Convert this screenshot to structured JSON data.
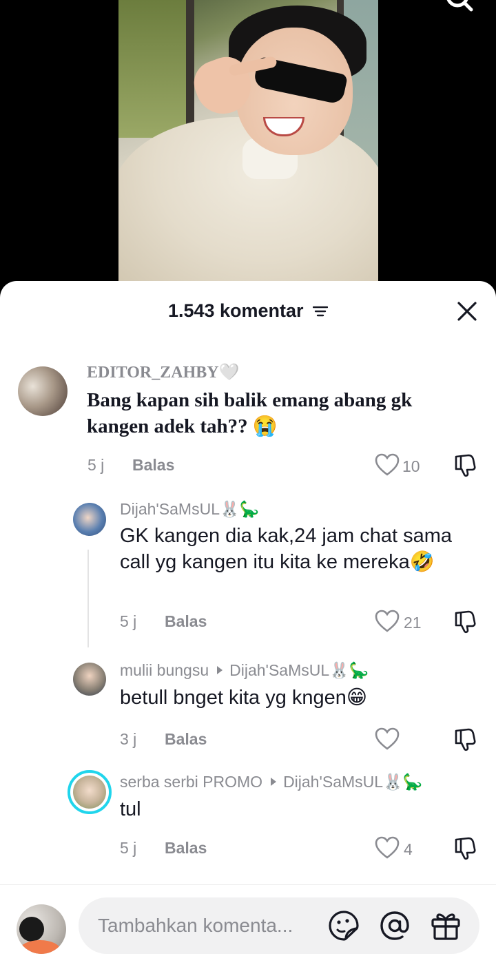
{
  "header": {
    "title": "1.543 komentar",
    "icons": [
      "filter-icon",
      "close-icon",
      "search-icon"
    ]
  },
  "comments": [
    {
      "username": "EDITOR_ZAHBY",
      "username_suffix": "🤍",
      "text": "Bang kapan sih balik emang abang gk kangen adek tah?? 😭",
      "time": "5 j",
      "reply_label": "Balas",
      "likes": "10"
    },
    {
      "username": "Dijah'SaMsUL🐰🦕",
      "text": "GK kangen dia kak,24 jam chat sama call yg kangen itu kita ke mereka🤣",
      "time": "5 j",
      "reply_label": "Balas",
      "likes": "21"
    },
    {
      "username": "mulii bungsu",
      "reply_to": "Dijah'SaMsUL🐰🦕",
      "text": "betull bnget kita yg kngen😁",
      "time": "3 j",
      "reply_label": "Balas",
      "likes": ""
    },
    {
      "username": "serba serbi PROMO",
      "reply_to": "Dijah'SaMsUL🐰🦕",
      "text": "tul",
      "time": "5 j",
      "reply_label": "Balas",
      "likes": "4"
    }
  ],
  "input": {
    "placeholder": "Tambahkan komenta..."
  },
  "colors": {
    "text_primary": "#161823",
    "text_secondary": "#8a8b91",
    "sheet_background": "#ffffff",
    "input_background": "#f1f1f2",
    "story_ring": "#20d5ec"
  }
}
